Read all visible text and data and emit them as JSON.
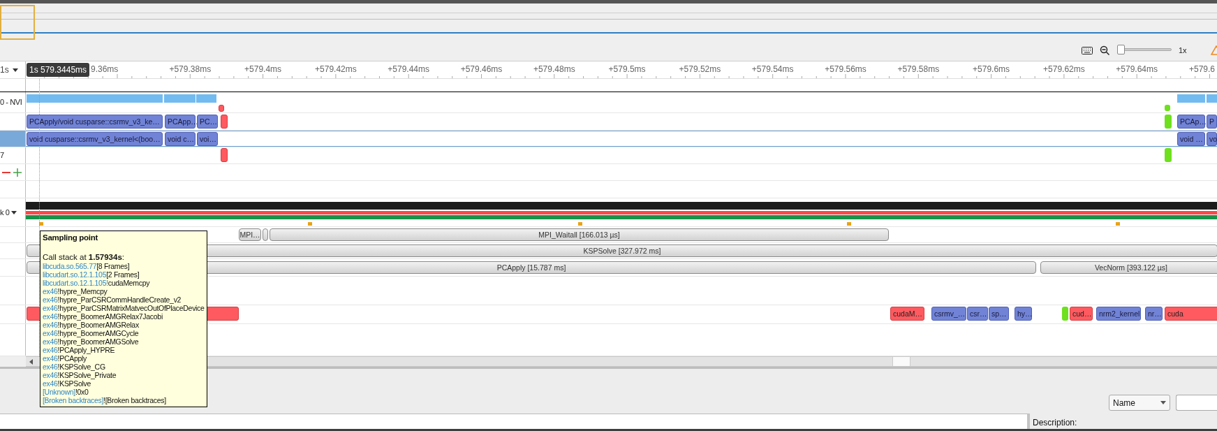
{
  "toolbar": {
    "zoom_slider": {
      "level": 0
    },
    "zoom_label": "1x"
  },
  "ruler": {
    "unit_menu": "1s",
    "cursor_time": "1s 579.3445ms",
    "ticks": [
      "9.36ms",
      "+579.38ms",
      "+579.4ms",
      "+579.42ms",
      "+579.44ms",
      "+579.46ms",
      "+579.48ms",
      "+579.5ms",
      "+579.52ms",
      "+579.54ms",
      "+579.56ms",
      "+579.58ms",
      "+579.6ms",
      "+579.62ms",
      "+579.64ms",
      "+579.6"
    ]
  },
  "tracks": [
    {
      "kind": "plain",
      "selected": false
    },
    {
      "kind": "plain",
      "label": "0 - NVI",
      "selected": false,
      "blocks": [
        {
          "kind": "activity"
        },
        {
          "kind": "activity"
        },
        {
          "kind": "activity"
        },
        {
          "kind": "memcpy"
        },
        {
          "kind": "sync"
        },
        {
          "kind": "activity"
        },
        {
          "kind": "activity"
        }
      ]
    },
    {
      "kind": "plain",
      "selected": false,
      "blocks": [
        {
          "kind": "kernel",
          "text": "PCApply/void cusparse::csrmv_v3_ke…"
        },
        {
          "kind": "kernel",
          "text": "PCApp…"
        },
        {
          "kind": "kernel",
          "text": "PC…"
        },
        {
          "kind": "memcpy"
        },
        {
          "kind": "sync"
        },
        {
          "kind": "kernel",
          "text": "PCAp…"
        },
        {
          "kind": "kernel",
          "text": "P"
        }
      ]
    },
    {
      "kind": "plain",
      "selected": true,
      "blocks": [
        {
          "kind": "kernel",
          "text": "void cusparse::csrmv_v3_kernel<(boo…"
        },
        {
          "kind": "kernel",
          "text": "void c…"
        },
        {
          "kind": "kernel",
          "text": "voi…"
        },
        {
          "kind": "kernel",
          "text": "void …"
        },
        {
          "kind": "kernel",
          "text": "vo"
        }
      ]
    },
    {
      "kind": "plain",
      "label": "7",
      "selected": false,
      "blocks": [
        {
          "kind": "memcpy"
        },
        {
          "kind": "sync"
        }
      ]
    },
    {
      "kind": "controls",
      "selected": false
    },
    {
      "kind": "plain",
      "selected": false
    },
    {
      "kind": "menu",
      "label": "k 0",
      "selected": false,
      "blocks": [
        {
          "kind": "band",
          "color": "#1b1b1b"
        },
        {
          "kind": "band",
          "color": "#ff4747"
        },
        {
          "kind": "band",
          "color": "#17934a"
        },
        {
          "kind": "marker"
        },
        {
          "kind": "marker"
        },
        {
          "kind": "marker"
        },
        {
          "kind": "marker"
        },
        {
          "kind": "marker"
        }
      ]
    },
    {
      "kind": "plain",
      "selected": false,
      "blocks": [
        {
          "kind": "range",
          "text": "MPI…"
        },
        {
          "kind": "range"
        },
        {
          "kind": "range",
          "text": "MPI_Waitall [166.013 µs]"
        }
      ]
    },
    {
      "kind": "plain",
      "selected": false,
      "blocks": [
        {
          "kind": "range",
          "text": "KSPSolve [327.972 ms]"
        }
      ]
    },
    {
      "kind": "plain",
      "selected": false,
      "blocks": [
        {
          "kind": "range",
          "text": "PCApply [15.787 ms]"
        },
        {
          "kind": "range",
          "text": "VecNorm [393.122 µs]"
        }
      ]
    },
    {
      "kind": "plain",
      "selected": false
    },
    {
      "kind": "plain",
      "selected": false,
      "blocks": [
        {
          "kind": "memcpy"
        },
        {
          "kind": "memcpy",
          "text": "cudaM…"
        },
        {
          "kind": "kernel",
          "text": "csrmv_…"
        },
        {
          "kind": "kernel",
          "text": "csr…"
        },
        {
          "kind": "kernel",
          "text": "sp…"
        },
        {
          "kind": "kernel",
          "text": "hy…"
        },
        {
          "kind": "sync"
        },
        {
          "kind": "memcpy",
          "text": "cud…"
        },
        {
          "kind": "kernel",
          "text": "nrm2_kernel"
        },
        {
          "kind": "kernel",
          "text": "nr…"
        },
        {
          "kind": "memcpy",
          "text": "cuda"
        }
      ]
    },
    {
      "kind": "plain",
      "selected": false
    }
  ],
  "tooltip": {
    "title": "Sampling point",
    "heading": "Call stack at **1.57934s**:",
    "frames": [
      {
        "module": "libcuda.so.565.77",
        "function": "[8 Frames]"
      },
      {
        "module": "libcudart.so.12.1.105",
        "function": "[2 Frames]"
      },
      {
        "module": "libcudart.so.12.1.105!",
        "function": "cudaMemcpy"
      },
      {
        "module": "ex46",
        "function": "!hypre_Memcpy"
      },
      {
        "module": "ex46",
        "function": "!hypre_ParCSRCommHandleCreate_v2"
      },
      {
        "module": "ex46",
        "function": "!hypre_ParCSRMatrixMatvecOutOfPlaceDevice"
      },
      {
        "module": "ex46",
        "function": "!hypre_BoomerAMGRelax7Jacobi"
      },
      {
        "module": "ex46",
        "function": "!hypre_BoomerAMGRelax"
      },
      {
        "module": "ex46",
        "function": "!hypre_BoomerAMGCycle"
      },
      {
        "module": "ex46",
        "function": "!hypre_BoomerAMGSolve"
      },
      {
        "module": "ex46",
        "function": "!PCApply_HYPRE"
      },
      {
        "module": "ex46",
        "function": "!PCApply"
      },
      {
        "module": "ex46",
        "function": "!KSPSolve_CG"
      },
      {
        "module": "ex46",
        "function": "!KSPSolve_Private"
      },
      {
        "module": "ex46",
        "function": "!KSPSolve"
      },
      {
        "module": "[Unknown]",
        "function": "!0x0"
      },
      {
        "module": "[Broken backtraces]",
        "function": "![Broken backtraces]"
      }
    ]
  },
  "bottom": {
    "filter_select": "Name",
    "description_label": "Description:"
  }
}
